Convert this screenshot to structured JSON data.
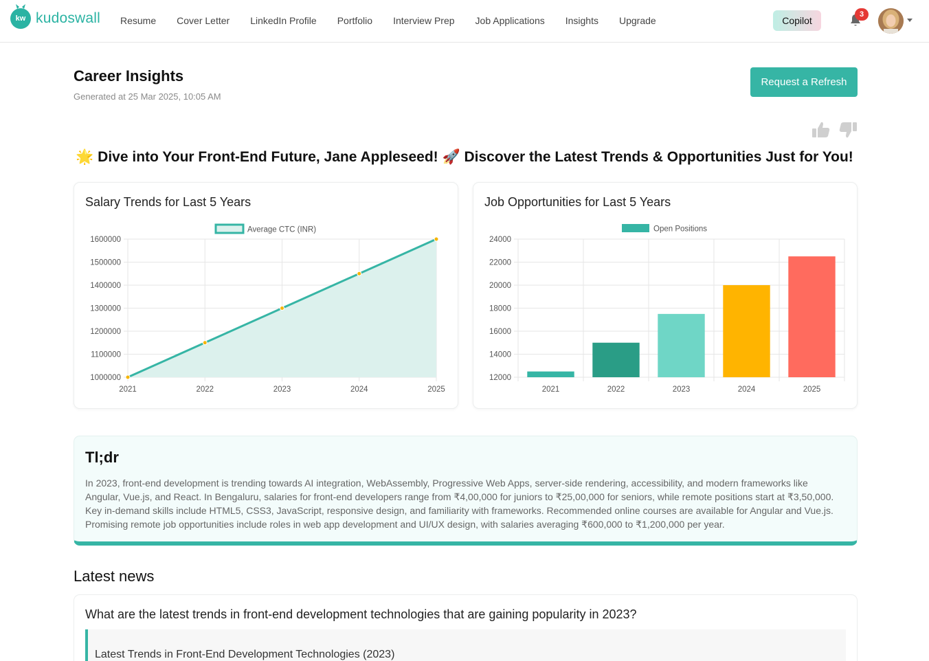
{
  "nav": {
    "logo_text": "kudoswall",
    "logo_badge": "kw",
    "links": [
      "Resume",
      "Cover Letter",
      "LinkedIn Profile",
      "Portfolio",
      "Interview Prep",
      "Job Applications",
      "Insights",
      "Upgrade"
    ],
    "copilot_label": "Copilot",
    "notification_count": "3"
  },
  "header": {
    "title": "Career Insights",
    "generated": "Generated at 25 Mar 2025, 10:05 AM",
    "refresh_label": "Request a Refresh"
  },
  "hero": "🌟 Dive into Your Front-End Future, Jane Appleseed! 🚀 Discover the Latest Trends & Opportunities Just for You!",
  "charts": {
    "salary_title": "Salary Trends for Last 5 Years",
    "jobs_title": "Job Opportunities for Last 5 Years"
  },
  "chart_data": [
    {
      "type": "area",
      "title": "Salary Trends for Last 5 Years",
      "legend": "top",
      "grid": true,
      "categories": [
        "2021",
        "2022",
        "2023",
        "2024",
        "2025"
      ],
      "series": [
        {
          "name": "Average CTC (INR)",
          "values": [
            1000000,
            1150000,
            1300000,
            1450000,
            1600000
          ]
        }
      ],
      "yticks": [
        "1600000",
        "1500000",
        "1400000",
        "1300000",
        "1200000",
        "1100000",
        "1000000"
      ],
      "ylim": [
        1000000,
        1600000
      ],
      "colors": {
        "line": "#36b5a5",
        "fill": "#dcf1ed",
        "point": "#f5b400"
      }
    },
    {
      "type": "bar",
      "title": "Job Opportunities for Last 5 Years",
      "legend": "top",
      "grid": true,
      "categories": [
        "2021",
        "2022",
        "2023",
        "2024",
        "2025"
      ],
      "series": [
        {
          "name": "Open Positions",
          "values": [
            12500,
            15000,
            17500,
            20000,
            22500
          ]
        }
      ],
      "yticks": [
        "24000",
        "22000",
        "20000",
        "18000",
        "16000",
        "14000",
        "12000"
      ],
      "ylim": [
        12000,
        24000
      ],
      "colors": {
        "legend": "#36b5a5",
        "bars": [
          "#36b5a5",
          "#2a9d86",
          "#6fd6c6",
          "#ffb400",
          "#ff6b5e"
        ]
      }
    }
  ],
  "tldr": {
    "title": "Tl;dr",
    "body": "In 2023, front-end development is trending towards AI integration, WebAssembly, Progressive Web Apps, server-side rendering, accessibility, and modern frameworks like Angular, Vue.js, and React. In Bengaluru, salaries for front-end developers range from ₹4,00,000 for juniors to ₹25,00,000 for seniors, while remote positions start at ₹3,50,000. Key in-demand skills include HTML5, CSS3, JavaScript, responsive design, and familiarity with frameworks. Recommended online courses are available for Angular and Vue.js. Promising remote job opportunities include roles in web app development and UI/UX design, with salaries averaging ₹600,000 to ₹1,200,000 per year."
  },
  "news": {
    "title": "Latest news",
    "question": "What are the latest trends in front-end development technologies that are gaining popularity in 2023?",
    "quote": "Latest Trends in Front-End Development Technologies (2023)"
  }
}
